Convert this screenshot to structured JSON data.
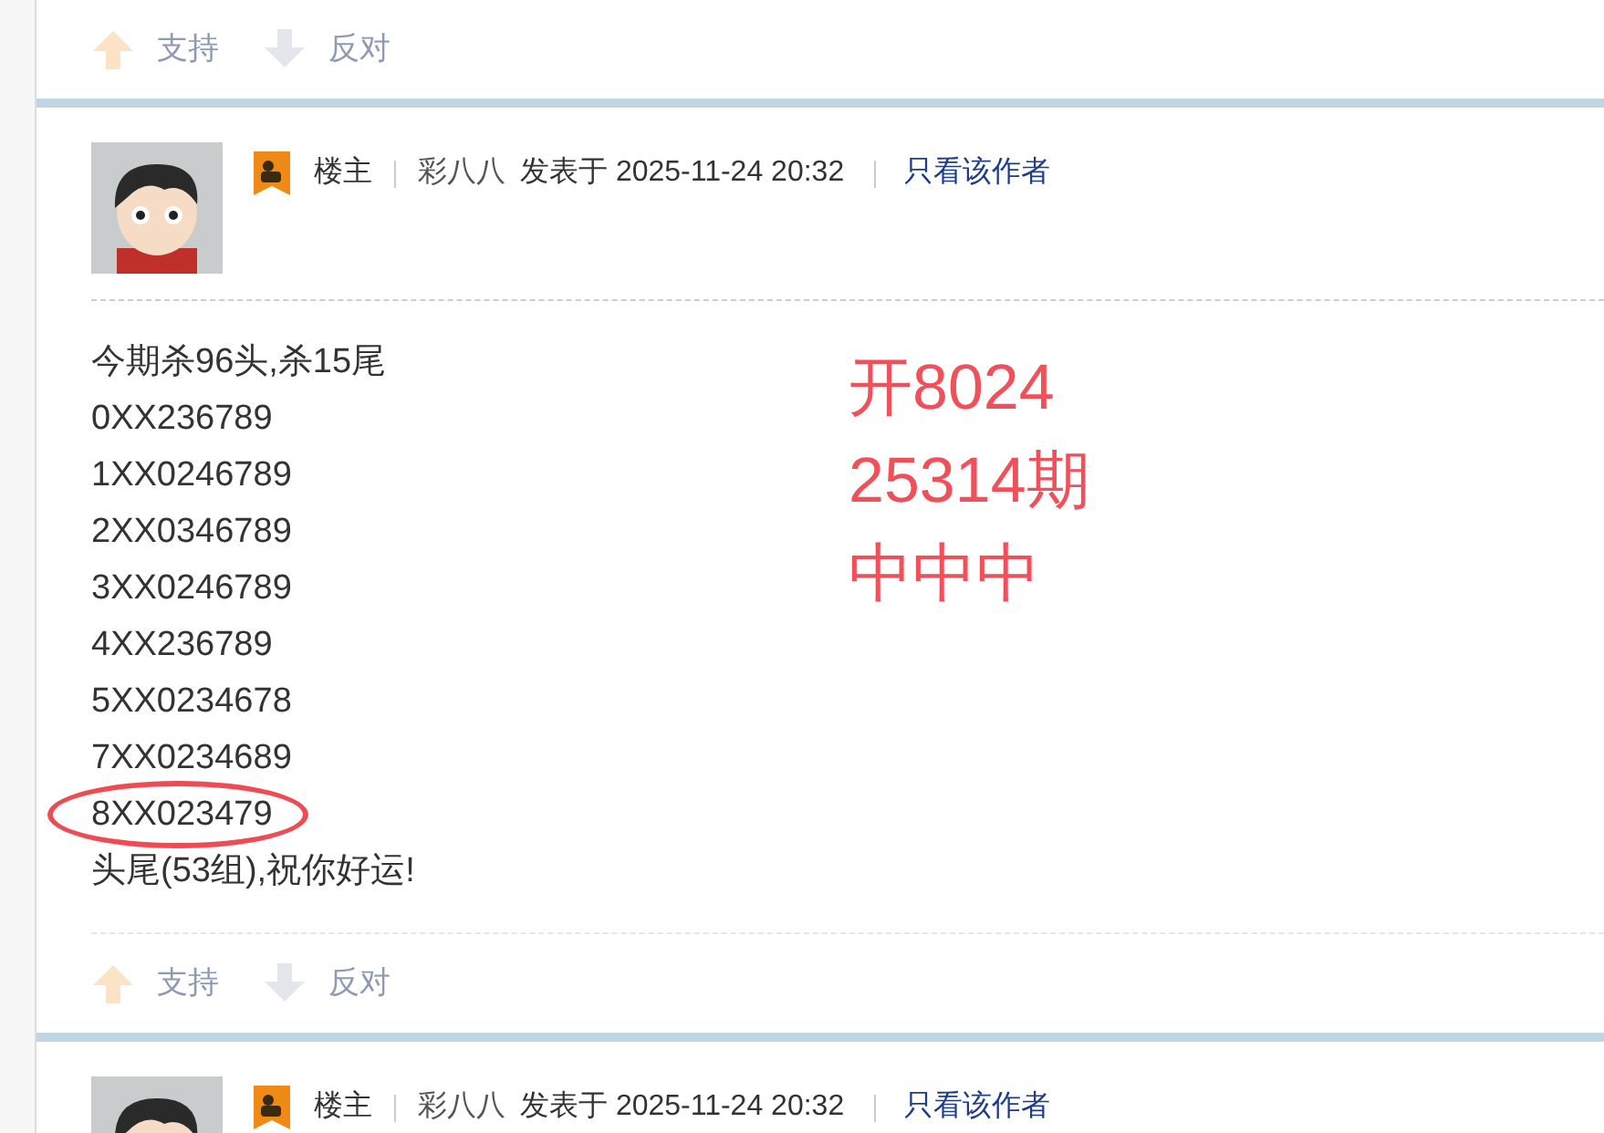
{
  "top_votes": {
    "support": "支持",
    "oppose": "反对"
  },
  "post": {
    "badge": "楼主",
    "author": "彩八八",
    "posted": "发表于 2025-11-24 20:32",
    "only_author": "只看该作者",
    "lines": [
      {
        "text": "今期杀96头,杀15尾",
        "circled": false
      },
      {
        "text": "0XX236789",
        "circled": false
      },
      {
        "text": "1XX0246789",
        "circled": false
      },
      {
        "text": "2XX0346789",
        "circled": false
      },
      {
        "text": "3XX0246789",
        "circled": false
      },
      {
        "text": "4XX236789",
        "circled": false
      },
      {
        "text": "5XX0234678",
        "circled": false
      },
      {
        "text": "7XX0234689",
        "circled": false
      },
      {
        "text": "8XX023479",
        "circled": true
      },
      {
        "text": "头尾(53组),祝你好运!",
        "circled": false
      }
    ],
    "annotation": [
      "开8024",
      "25314期",
      "中中中"
    ],
    "votes": {
      "support": "支持",
      "oppose": "反对"
    }
  },
  "next_post": {
    "badge": "楼主",
    "author": "彩八八",
    "posted": "发表于 2025-11-24 20:32",
    "only_author": "只看该作者"
  }
}
